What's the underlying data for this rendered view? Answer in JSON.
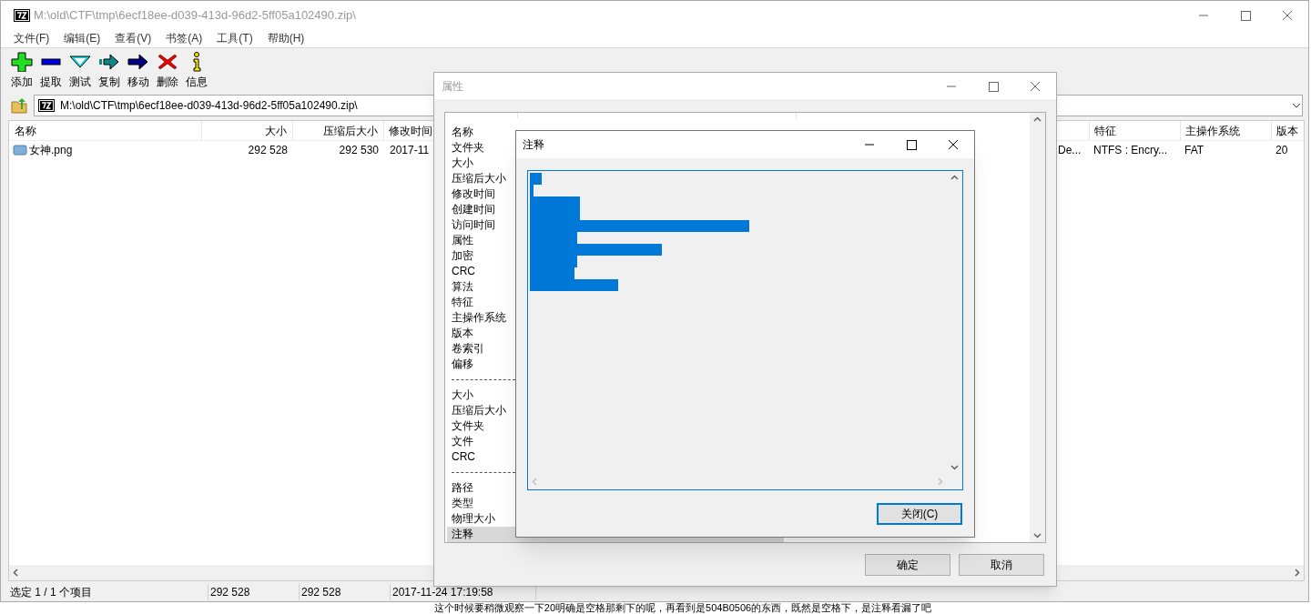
{
  "window": {
    "title": "M:\\old\\CTF\\tmp\\6ecf18ee-d039-413d-96d2-5ff05a102490.zip\\"
  },
  "menu": [
    "文件(F)",
    "编辑(E)",
    "查看(V)",
    "书签(A)",
    "工具(T)",
    "帮助(H)"
  ],
  "toolbar": [
    {
      "kind": "add",
      "label": "添加"
    },
    {
      "kind": "extract",
      "label": "提取"
    },
    {
      "kind": "test",
      "label": "测试"
    },
    {
      "kind": "copy",
      "label": "复制"
    },
    {
      "kind": "move",
      "label": "移动"
    },
    {
      "kind": "delete",
      "label": "删除"
    },
    {
      "kind": "info",
      "label": "信息"
    }
  ],
  "address": {
    "value": "M:\\old\\CTF\\tmp\\6ecf18ee-d039-413d-96d2-5ff05a102490.zip\\"
  },
  "file_list": {
    "columns": [
      "名称",
      "大小",
      "压缩后大小",
      "修改时间"
    ],
    "right_columns": [
      "特征",
      "主操作系统",
      "版本"
    ],
    "rows": [
      {
        "name": "女神.png",
        "size": "292 528",
        "packed": "292 530",
        "modified": "2017-11",
        "column_5": "De...",
        "features": "NTFS : Encry...",
        "host_os": "FAT",
        "version": "20"
      }
    ]
  },
  "status_bar": [
    "选定 1 / 1 个项目",
    "292 528",
    "292 528",
    "2017-11-24 17:19:58"
  ],
  "caption": "这个时候要稍微观察一下20明确是空格那剩下的呢，再看到是504B0506的东西，既然是空格下，是注释看漏了吧",
  "properties_dialog": {
    "title": "属性",
    "items": [
      {
        "kind": "item",
        "label": "名称",
        "selected": false
      },
      {
        "kind": "item",
        "label": "文件夹",
        "selected": false
      },
      {
        "kind": "item",
        "label": "大小",
        "selected": false
      },
      {
        "kind": "item",
        "label": "压缩后大小",
        "selected": false
      },
      {
        "kind": "item",
        "label": "修改时间",
        "selected": false
      },
      {
        "kind": "item",
        "label": "创建时间",
        "selected": false
      },
      {
        "kind": "item",
        "label": "访问时间",
        "selected": false
      },
      {
        "kind": "item",
        "label": "属性",
        "selected": false
      },
      {
        "kind": "item",
        "label": "加密",
        "selected": false
      },
      {
        "kind": "item",
        "label": "CRC",
        "selected": false
      },
      {
        "kind": "item",
        "label": "算法",
        "selected": false
      },
      {
        "kind": "item",
        "label": "特征",
        "selected": false
      },
      {
        "kind": "item",
        "label": "主操作系统",
        "selected": false
      },
      {
        "kind": "item",
        "label": "版本",
        "selected": false
      },
      {
        "kind": "item",
        "label": "卷索引",
        "selected": false
      },
      {
        "kind": "item",
        "label": "偏移",
        "selected": false
      },
      {
        "kind": "separator"
      },
      {
        "kind": "item",
        "label": "大小",
        "selected": false
      },
      {
        "kind": "item",
        "label": "压缩后大小",
        "selected": false
      },
      {
        "kind": "item",
        "label": "文件夹",
        "selected": false
      },
      {
        "kind": "item",
        "label": "文件",
        "selected": false
      },
      {
        "kind": "item",
        "label": "CRC",
        "selected": false
      },
      {
        "kind": "separator"
      },
      {
        "kind": "item",
        "label": "路径",
        "selected": false
      },
      {
        "kind": "item",
        "label": "类型",
        "selected": false
      },
      {
        "kind": "item",
        "label": "物理大小",
        "selected": false
      },
      {
        "kind": "item",
        "label": "注释",
        "selected": true
      }
    ],
    "buttons": [
      "确定",
      "取消"
    ]
  },
  "comment_dialog": {
    "title": "注释",
    "close_button": "关闭(C)"
  }
}
